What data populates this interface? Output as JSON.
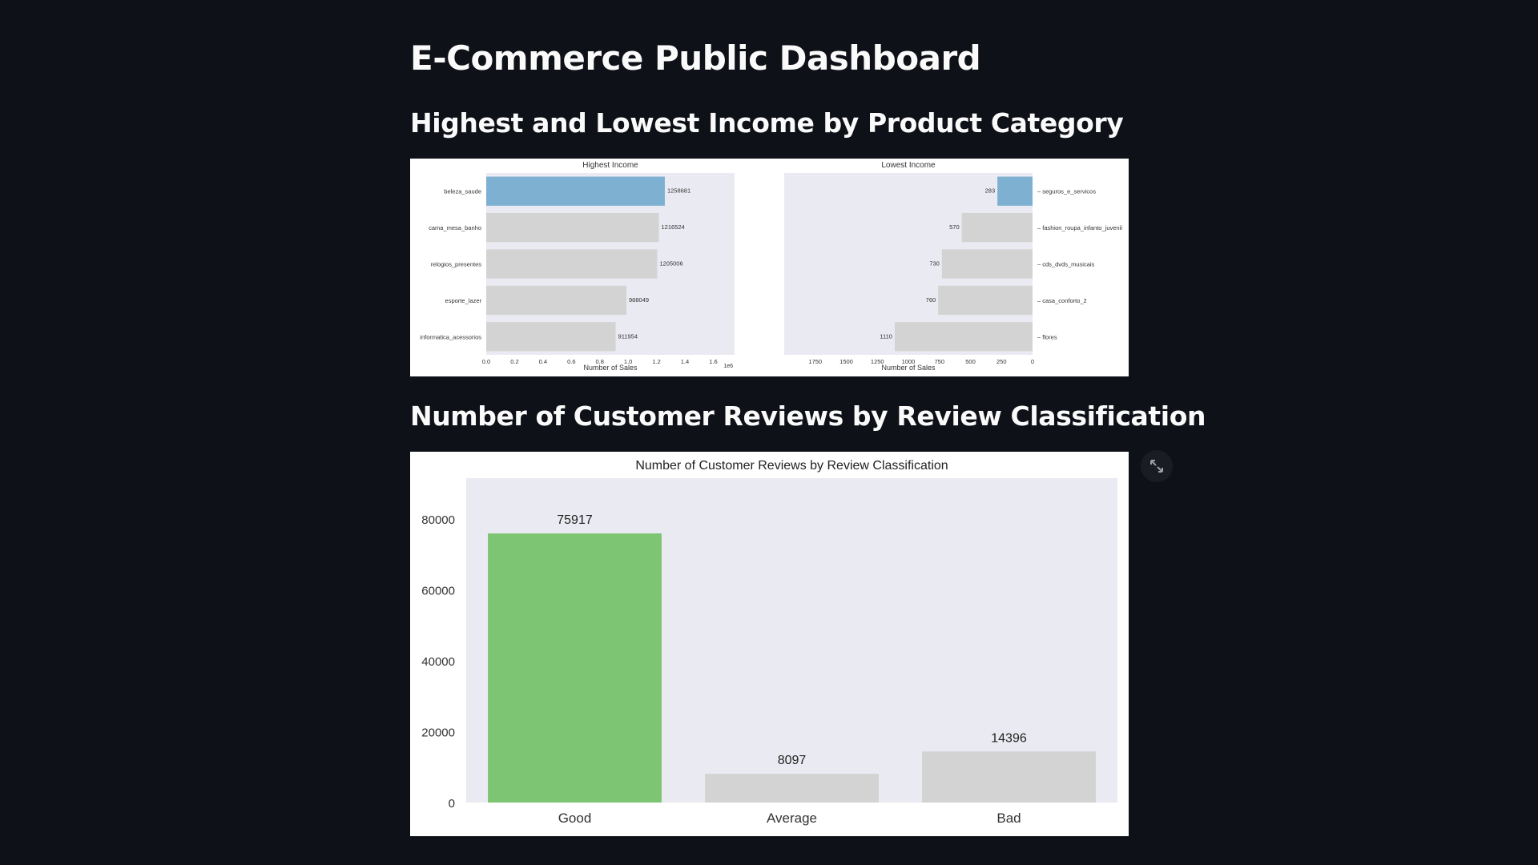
{
  "page": {
    "title": "E-Commerce Public Dashboard",
    "subheader_income": "Highest and Lowest Income by Product Category",
    "subheader_reviews": "Number of Customer Reviews by Review Classification"
  },
  "toolbar": {
    "fullscreen_icon": "expand-arrows-icon"
  },
  "colors": {
    "page_bg": "#0e1117",
    "plot_bg": "#eaeaf2",
    "highlight_blue": "#7eb0d2",
    "highlight_green": "#7dc572",
    "bar_grey": "#d3d3d3"
  },
  "chart_data": [
    {
      "type": "bar",
      "orientation": "horizontal",
      "title": "Highest Income",
      "xlabel": "Number of Sales",
      "ylabel": "",
      "x_tick_labels": [
        "0.0",
        "0.2",
        "0.4",
        "0.6",
        "0.8",
        "1.0",
        "1.2",
        "1.4",
        "1.6"
      ],
      "x_offset_label": "1e6",
      "xlim": [
        0,
        1750000
      ],
      "categories": [
        "beleza_saude",
        "cama_mesa_banho",
        "relogios_presentes",
        "esporte_lazer",
        "informatica_acessorios"
      ],
      "values": [
        1258681,
        1216524,
        1205006,
        988049,
        911954
      ],
      "highlight_index": 0,
      "grid": false
    },
    {
      "type": "bar",
      "orientation": "horizontal",
      "title": "Lowest Income",
      "xlabel": "Number of Sales",
      "ylabel": "",
      "x_inverted": true,
      "y_axis_position": "right",
      "x_tick_labels": [
        "1750",
        "1500",
        "1250",
        "1000",
        "750",
        "500",
        "250",
        "0"
      ],
      "xlim": [
        2000,
        0
      ],
      "categories": [
        "seguros_e_servicos",
        "fashion_roupa_infanto_juvenil",
        "cds_dvds_musicais",
        "casa_conforto_2",
        "flores"
      ],
      "values": [
        283,
        570,
        730,
        760,
        1110
      ],
      "highlight_index": 0,
      "grid": false
    },
    {
      "type": "bar",
      "title": "Number of Customer Reviews by Review Classification",
      "xlabel": "",
      "ylabel": "",
      "categories": [
        "Good",
        "Average",
        "Bad"
      ],
      "values": [
        75917,
        8097,
        14396
      ],
      "y_tick_labels": [
        "0",
        "20000",
        "40000",
        "60000",
        "80000"
      ],
      "ylim": [
        0,
        80000
      ],
      "highlight_index": 0,
      "grid": false
    }
  ]
}
